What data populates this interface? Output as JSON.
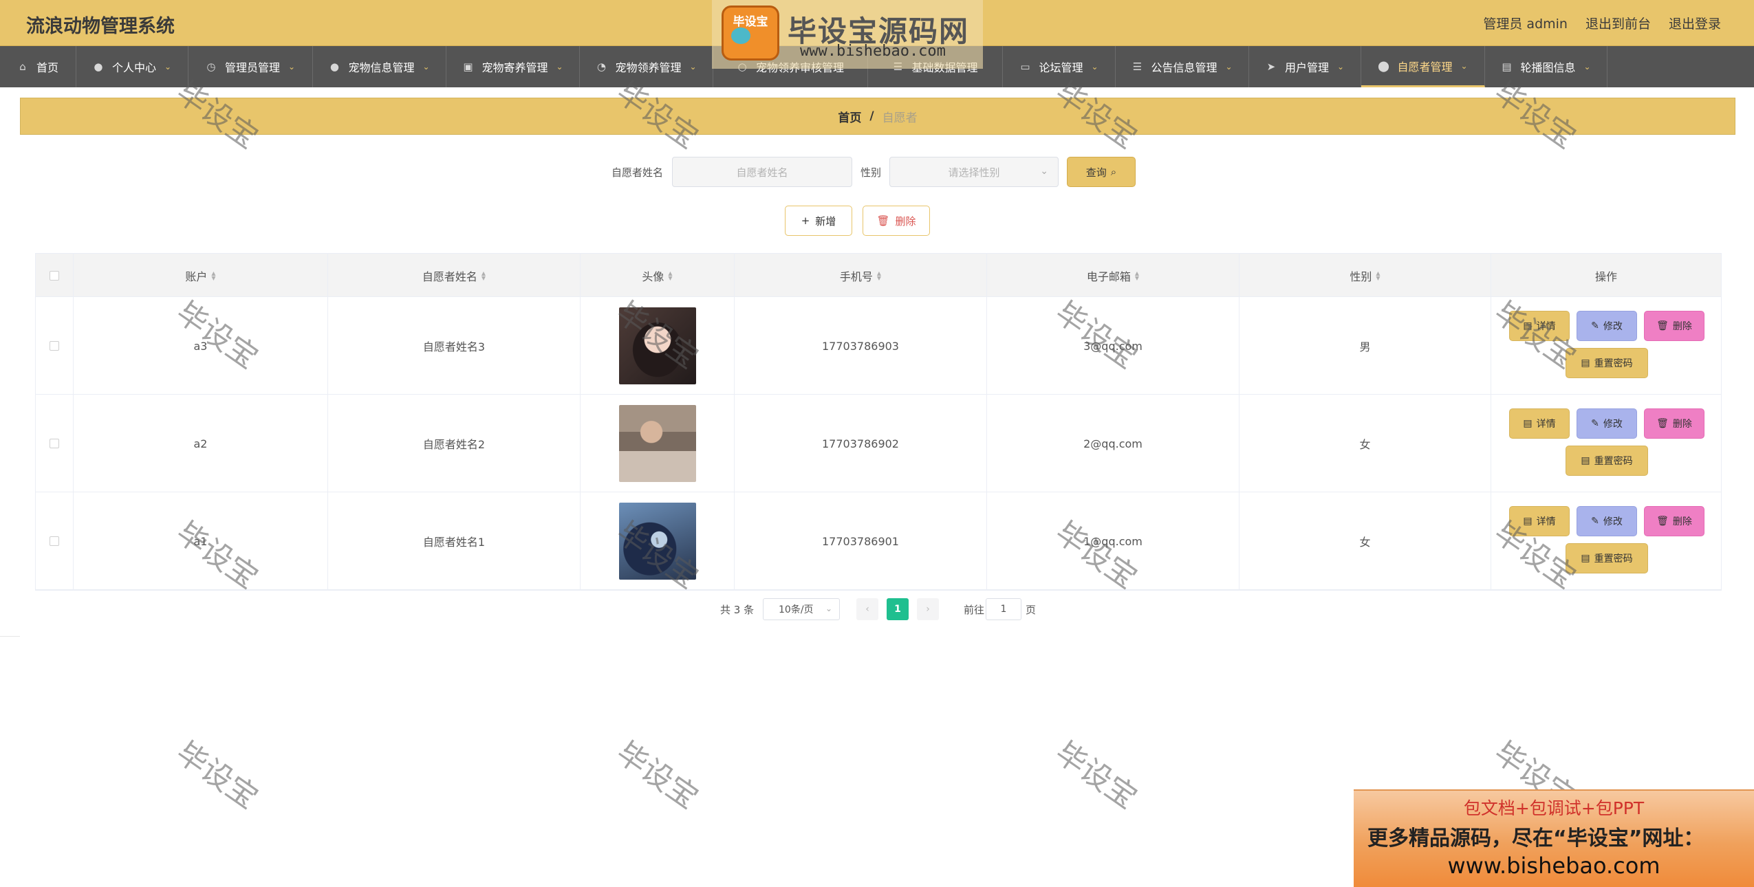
{
  "app": {
    "title": "流浪动物管理系统"
  },
  "header": {
    "user_label": "管理员 admin",
    "front_link": "退出到前台",
    "logout_link": "退出登录"
  },
  "nav": {
    "items": [
      {
        "label": "首页",
        "icon": "home-icon"
      },
      {
        "label": "个人中心",
        "icon": "user-icon"
      },
      {
        "label": "管理员管理",
        "icon": "clock-icon"
      },
      {
        "label": "宠物信息管理",
        "icon": "user-icon"
      },
      {
        "label": "宠物寄养管理",
        "icon": "briefcase-icon"
      },
      {
        "label": "宠物领养管理",
        "icon": "gauge-icon"
      },
      {
        "label": "宠物领养审核管理",
        "icon": "circle-icon"
      },
      {
        "label": "基础数据管理",
        "icon": "list-icon"
      },
      {
        "label": "论坛管理",
        "icon": "chat-icon"
      },
      {
        "label": "公告信息管理",
        "icon": "list-icon"
      },
      {
        "label": "用户管理",
        "icon": "send-icon"
      },
      {
        "label": "自愿者管理",
        "icon": "location-icon"
      },
      {
        "label": "轮播图信息",
        "icon": "clipboard-icon"
      }
    ]
  },
  "breadcrumb": {
    "home": "首页",
    "separator": "/",
    "current": "自愿者"
  },
  "search": {
    "name_label": "自愿者姓名",
    "name_placeholder": "自愿者姓名",
    "gender_label": "性别",
    "gender_placeholder": "请选择性别",
    "query_label": "查询"
  },
  "actions": {
    "add_label": "新增",
    "delete_label": "删除"
  },
  "table": {
    "columns": [
      "账户",
      "自愿者姓名",
      "头像",
      "手机号",
      "电子邮箱",
      "性别",
      "操作"
    ],
    "rows": [
      {
        "account": "a3",
        "name": "自愿者姓名3",
        "phone": "17703786903",
        "email": "3@qq.com",
        "gender": "男"
      },
      {
        "account": "a2",
        "name": "自愿者姓名2",
        "phone": "17703786902",
        "email": "2@qq.com",
        "gender": "女"
      },
      {
        "account": "a1",
        "name": "自愿者姓名1",
        "phone": "17703786901",
        "email": "1@qq.com",
        "gender": "女"
      }
    ],
    "row_actions": {
      "detail": "详情",
      "edit": "修改",
      "delete": "删除",
      "reset_password": "重置密码"
    }
  },
  "pagination": {
    "total": "共 3 条",
    "page_size": "10条/页",
    "current_page": "1",
    "goto_label": "前往",
    "goto_value": "1",
    "unit": "页"
  },
  "watermark": {
    "text": "毕设宝"
  },
  "logo": {
    "badge": "毕设宝",
    "name": "毕设宝源码网",
    "url": "www.bishebao.com"
  },
  "promo": {
    "line1": "包文档+包调试+包PPT",
    "line2": "更多精品源码，尽在“毕设宝”网址：",
    "line3": "www.bishebao.com"
  },
  "colors": {
    "accent": "#e8c56b",
    "nav_bg": "#545454",
    "edit": "#a9b3ec",
    "delete": "#ef7fc4",
    "page_active": "#1fbf8f"
  }
}
